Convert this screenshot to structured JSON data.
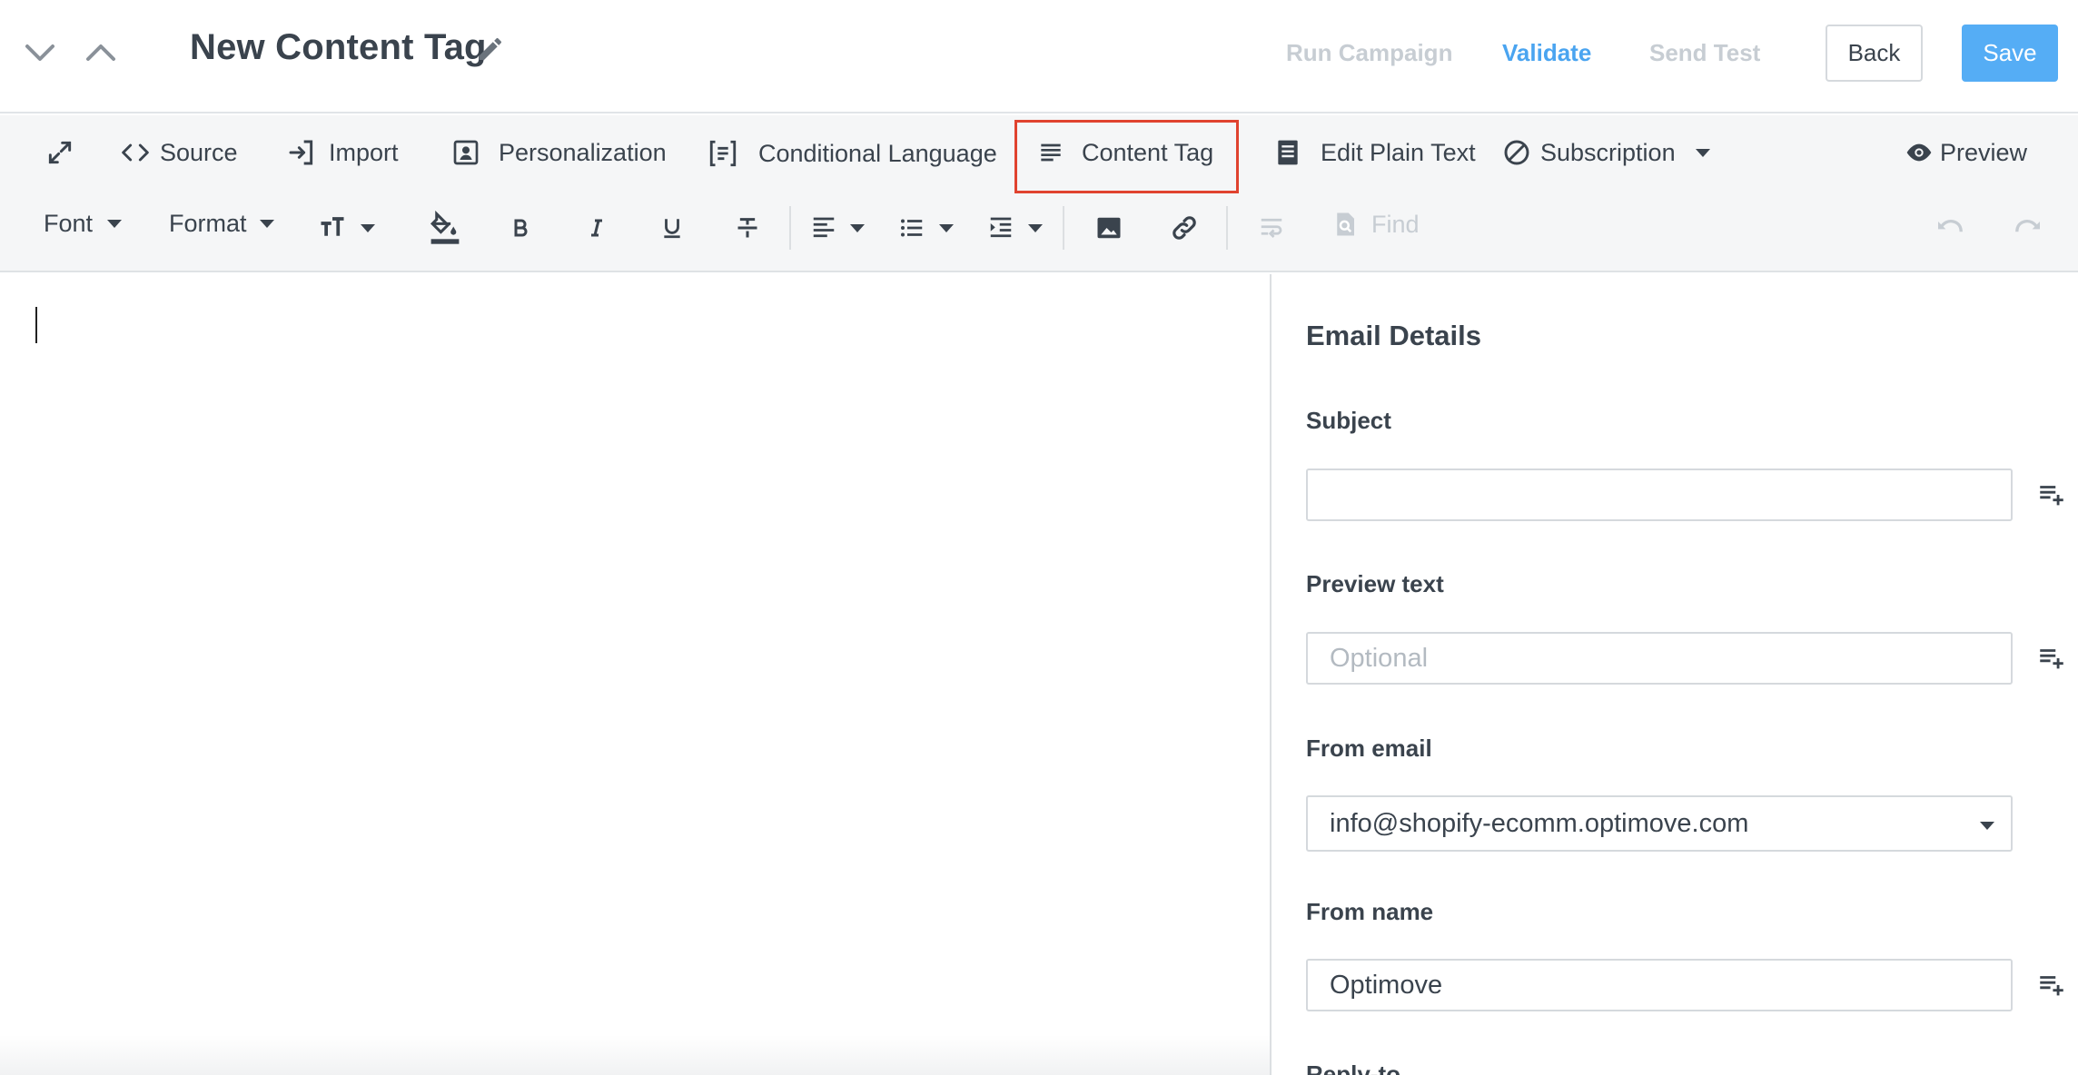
{
  "header": {
    "title": "New Content Tag",
    "run_campaign": "Run Campaign",
    "validate": "Validate",
    "send_test": "Send Test",
    "back": "Back",
    "save": "Save"
  },
  "toolbar": {
    "source": "Source",
    "import": "Import",
    "personalization": "Personalization",
    "conditional_language": "Conditional Language",
    "content_tag": "Content Tag",
    "edit_plain_text": "Edit Plain Text",
    "subscription": "Subscription",
    "preview": "Preview",
    "font": "Font",
    "format": "Format",
    "find": "Find"
  },
  "panel": {
    "title": "Email Details",
    "subject_label": "Subject",
    "subject_value": "",
    "preview_text_label": "Preview text",
    "preview_text_placeholder": "Optional",
    "from_email_label": "From email",
    "from_email_value": "info@shopify-ecomm.optimove.com",
    "from_name_label": "From name",
    "from_name_value": "Optimove",
    "reply_to_label": "Reply-to"
  },
  "colors": {
    "accent": "#55adf5",
    "validate_link": "#4aa4f0",
    "disabled_link": "#c7cdd3",
    "highlight_box": "#e0432f",
    "text": "#3a434d",
    "toolbar_bg": "#f5f6f7"
  },
  "icons": {
    "nav_down": "chevron-down-icon",
    "nav_up": "chevron-up-icon",
    "edit": "pencil-icon",
    "fullscreen": "expand-icon",
    "source": "code-icon",
    "import": "import-icon",
    "personalization": "person-card-icon",
    "conditional": "bracket-lines-icon",
    "content_tag": "lines-icon",
    "plain_text": "document-icon",
    "subscription": "blocked-circle-icon",
    "preview": "eye-icon",
    "add_field": "playlist-add-icon"
  }
}
